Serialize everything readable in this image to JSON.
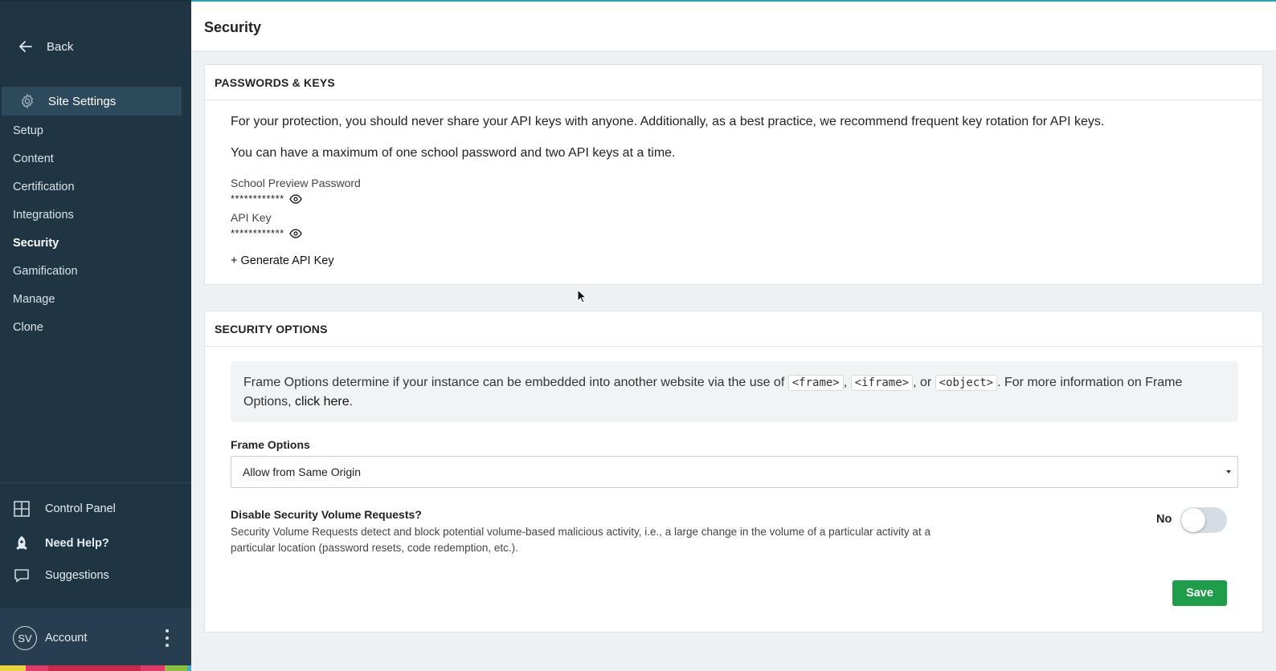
{
  "sidebar": {
    "back_label": "Back",
    "site_settings_label": "Site Settings",
    "items": [
      {
        "label": "Setup"
      },
      {
        "label": "Content"
      },
      {
        "label": "Certification"
      },
      {
        "label": "Integrations"
      },
      {
        "label": "Security",
        "active": true
      },
      {
        "label": "Gamification"
      },
      {
        "label": "Manage"
      },
      {
        "label": "Clone"
      }
    ],
    "control_panel_label": "Control Panel",
    "need_help_label": "Need Help?",
    "suggestions_label": "Suggestions",
    "account_initials": "SV",
    "account_label": "Account",
    "icons": {
      "back": "arrow-left-icon",
      "site_settings": "gear-icon",
      "control_panel": "grid-icon",
      "need_help": "rocket-icon",
      "suggestions": "speech-bubble-icon",
      "account_menu": "kebab-menu-icon"
    }
  },
  "header": {
    "title": "Security"
  },
  "passwords_keys": {
    "title": "PASSWORDS & KEYS",
    "intro": "For your protection, you should never share your API keys with anyone. Additionally, as a best practice, we recommend frequent key rotation for API keys.",
    "limit_note": "You can have a maximum of one school password and two API keys at a time.",
    "school_password_label": "School Preview Password",
    "school_password_masked": "************",
    "api_key_label": "API Key",
    "api_key_masked": "************",
    "generate_label": "+ Generate API Key"
  },
  "security_options": {
    "title": "SECURITY OPTIONS",
    "info_part1": "Frame Options determine if your instance can be embedded into another website via the use of",
    "code_frame": "<frame>",
    "code_iframe": "<iframe>",
    "code_object": "<object>",
    "info_sep1": ",",
    "info_sep2": ", or",
    "info_part2": ". For more information on Frame Options,",
    "info_link": "click here",
    "info_end": ".",
    "frame_options_label": "Frame Options",
    "frame_options_value": "Allow from Same Origin",
    "dsv_label": "Disable Security Volume Requests?",
    "dsv_description": "Security Volume Requests detect and block potential volume-based malicious activity, i.e., a large change in the volume of a particular activity at a particular location (password resets, code redemption, etc.).",
    "toggle_state_label": "No",
    "toggle_on": false,
    "save_label": "Save"
  },
  "colors": {
    "sidebar_bg": "#203544",
    "sidebar_active": "#2d4a5d",
    "accent_top": "#26a9b5",
    "save_green": "#1f9d4a",
    "colorbar": [
      "#e8d33a",
      "#e03a6b",
      "#c92a4a",
      "#e03a6b",
      "#8bbf3f",
      "#3fa9d9"
    ]
  }
}
